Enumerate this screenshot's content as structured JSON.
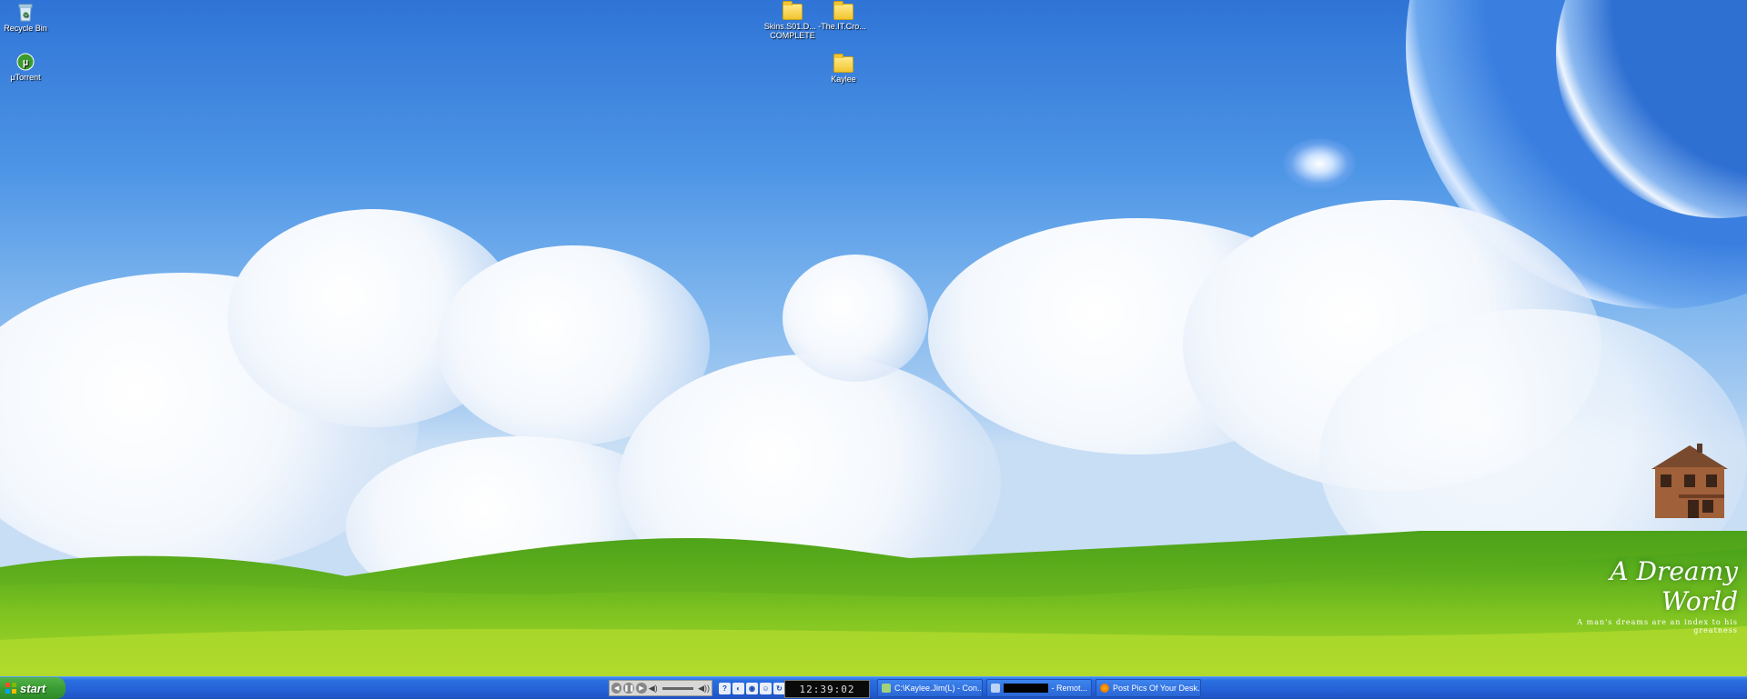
{
  "desktop": {
    "icons": [
      {
        "label": "Recycle Bin",
        "icon": "recycle-bin-icon"
      },
      {
        "label": "µTorrent",
        "icon": "utorrent-icon"
      },
      {
        "label": "Skins.S01.D... - COMPLETE",
        "icon": "folder-icon"
      },
      {
        "label": "The.IT.Cro...",
        "icon": "folder-icon"
      },
      {
        "label": "Kaylee",
        "icon": "folder-icon"
      }
    ],
    "wallpaper": {
      "title": "A Dreamy World",
      "subtitle": "A man's dreams are an index to his greatness"
    }
  },
  "taskbar": {
    "start_label": "start",
    "media_controls": [
      "previous",
      "pause",
      "next",
      "volume"
    ],
    "quick_launch": [
      "help-icon",
      "back-icon",
      "globe-icon",
      "messenger-icon",
      "refresh-icon"
    ],
    "clock": "12:39:02",
    "tasks": [
      {
        "label": "C:\\Kaylee.Jim(L) - Con...",
        "icon": "console-icon"
      },
      {
        "label": "- Remot...",
        "icon": "remote-desktop-icon"
      },
      {
        "label": "Post Pics Of Your Desk...",
        "icon": "firefox-icon"
      }
    ]
  },
  "colors": {
    "taskbar": "#2561d6",
    "start": "#3a9d33",
    "sky": "#4d95e6",
    "grass": "#7ec321"
  }
}
